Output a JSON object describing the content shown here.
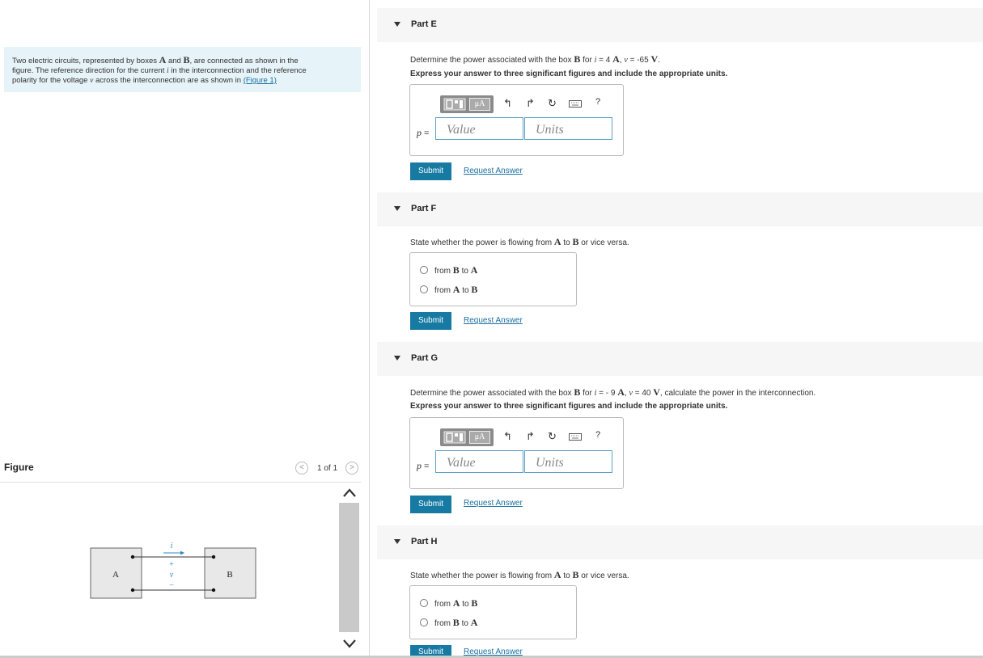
{
  "problem": {
    "line1_pre": "Two electric circuits, represented by boxes ",
    "A": "A",
    "and": " and ",
    "B": "B",
    "line1_post": ", are connected as shown in the",
    "line2_pre": "figure. The reference direction for the current ",
    "i": "i",
    "line2_post": " in the interconnection and the reference",
    "line3_pre": "polarity for the voltage ",
    "v": "v",
    "line3_mid": " across the interconnection are as shown in ",
    "link": "(Figure 1)"
  },
  "figure": {
    "title": "Figure",
    "prev": "<",
    "next": ">",
    "count": "1 of 1",
    "box_a": "A",
    "box_b": "B",
    "current": "i",
    "plus": "+",
    "voltage": "v",
    "minus": "–"
  },
  "parts": {
    "e": {
      "label": "Part E",
      "q_pre": "Determine the power associated with the box ",
      "q_B": "B",
      "q_for": " for ",
      "q_i": "i",
      "q_eq1": " = 4 ",
      "q_A": "A",
      "q_comma": ", ",
      "q_v": "v",
      "q_eq2": " = -65 ",
      "q_V": "V",
      "q_end": ".",
      "instruction": "Express your answer to three significant figures and include the appropriate units.",
      "var": "p",
      "eq": " =",
      "value_ph": "Value",
      "units_ph": "Units",
      "submit": "Submit",
      "request": "Request Answer"
    },
    "f": {
      "label": "Part F",
      "q_pre": "State whether the power is flowing from ",
      "q_A": "A",
      "q_to": " to ",
      "q_B": "B",
      "q_post": " or vice versa.",
      "options": [
        {
          "pre": "from ",
          "x": "B",
          "mid": " to ",
          "y": "A"
        },
        {
          "pre": "from ",
          "x": "A",
          "mid": " to ",
          "y": "B"
        }
      ],
      "submit": "Submit",
      "request": "Request Answer"
    },
    "g": {
      "label": "Part G",
      "q_pre": "Determine the power associated with the box ",
      "q_B": "B",
      "q_for": " for ",
      "q_i": "i",
      "q_eq1": " = - 9 ",
      "q_A": "A",
      "q_comma": ", ",
      "q_v": "v",
      "q_eq2": " = 40 ",
      "q_V": "V",
      "q_end": ", calculate the power in the interconnection.",
      "instruction": "Express your answer to three significant figures and include the appropriate units.",
      "var": "p",
      "eq": " =",
      "value_ph": "Value",
      "units_ph": "Units",
      "submit": "Submit",
      "request": "Request Answer"
    },
    "h": {
      "label": "Part H",
      "q_pre": "State whether the power is flowing from ",
      "q_A": "A",
      "q_to": " to ",
      "q_B": "B",
      "q_post": " or vice versa.",
      "options": [
        {
          "pre": "from ",
          "x": "A",
          "mid": " to ",
          "y": "B"
        },
        {
          "pre": "from ",
          "x": "B",
          "mid": " to ",
          "y": "A"
        }
      ],
      "submit": "Submit",
      "request": "Request Answer"
    }
  },
  "toolbar": {
    "mu": "μA",
    "help": "?",
    "icons": [
      "templates-icon",
      "units-mu-icon",
      "undo-icon",
      "redo-icon",
      "reset-icon",
      "keyboard-icon",
      "help-icon"
    ]
  },
  "colors": {
    "accent": "#167aa3",
    "link": "#1a6fa0",
    "problem_bg": "#e6f3f8",
    "input_border": "#5aa0c8"
  }
}
